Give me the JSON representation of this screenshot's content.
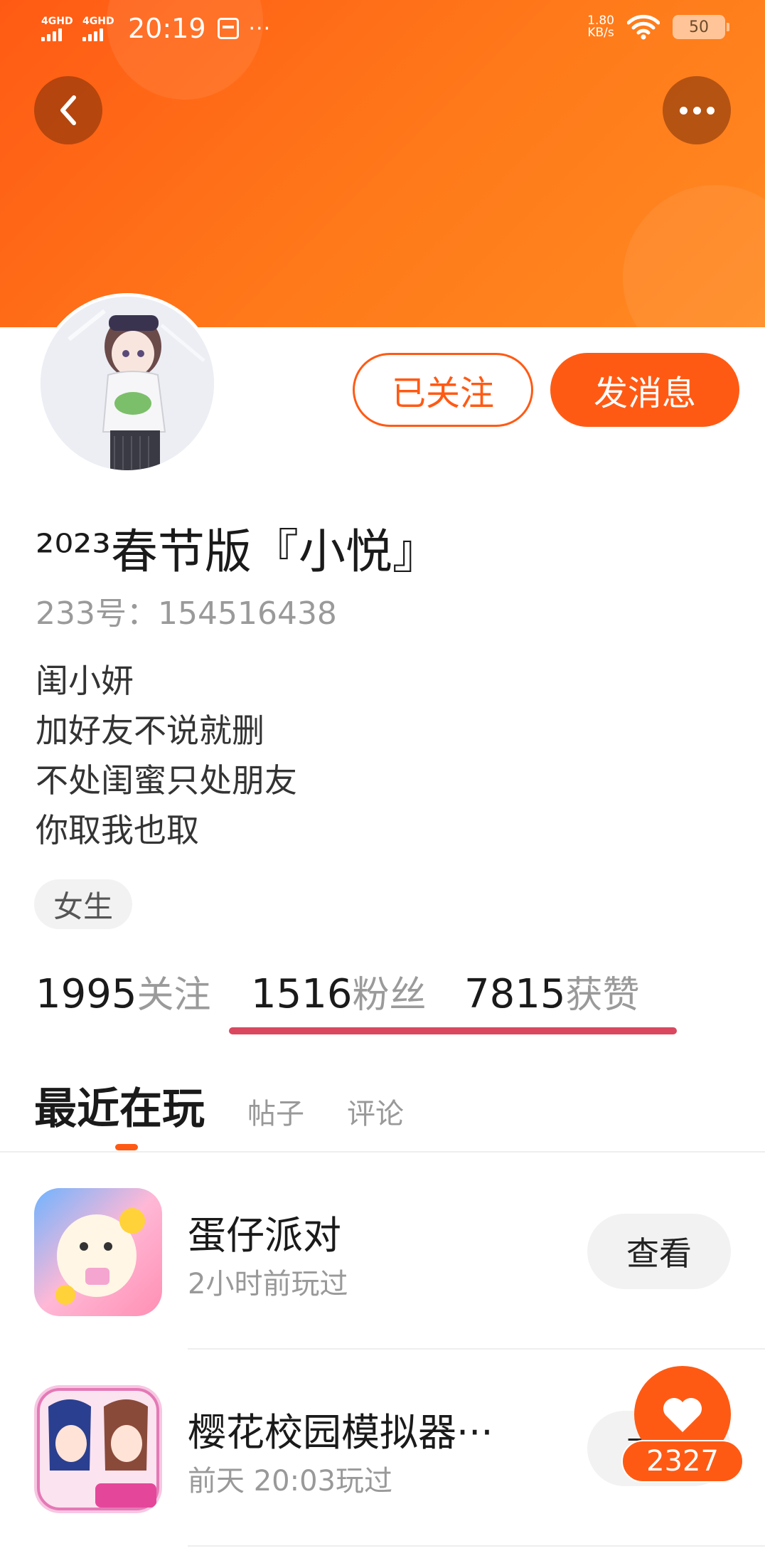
{
  "status_bar": {
    "sim1": "4GHD",
    "sim2": "4GHD",
    "time": "20:19",
    "more": "···",
    "speed_value": "1.80",
    "speed_unit": "KB/s",
    "battery": "50"
  },
  "profile": {
    "follow_button": "已关注",
    "message_button": "发消息",
    "nickname": "²⁰²³春节版『小悦』",
    "uid": "233号：154516438",
    "bio": [
      "闺小妍",
      "加好友不说就删",
      "不处闺蜜只处朋友",
      "你取我也取"
    ],
    "gender_tag": "女生"
  },
  "stats": {
    "following_count": "1995",
    "following_label": "关注",
    "fans_count": "1516",
    "fans_label": "粉丝",
    "likes_count": "7815",
    "likes_label": "获赞"
  },
  "tabs": {
    "active": "最近在玩",
    "items": [
      "帖子",
      "评论"
    ]
  },
  "games": [
    {
      "name": "蛋仔派对",
      "time": "2小时前玩过",
      "button": "查看"
    },
    {
      "name": "樱花校园模拟器···",
      "time": "前天 20:03玩过",
      "button": "查看"
    }
  ],
  "like_fab": {
    "count": "2327"
  },
  "colors": {
    "accent": "#ff5a14",
    "underline": "#d9485f"
  }
}
